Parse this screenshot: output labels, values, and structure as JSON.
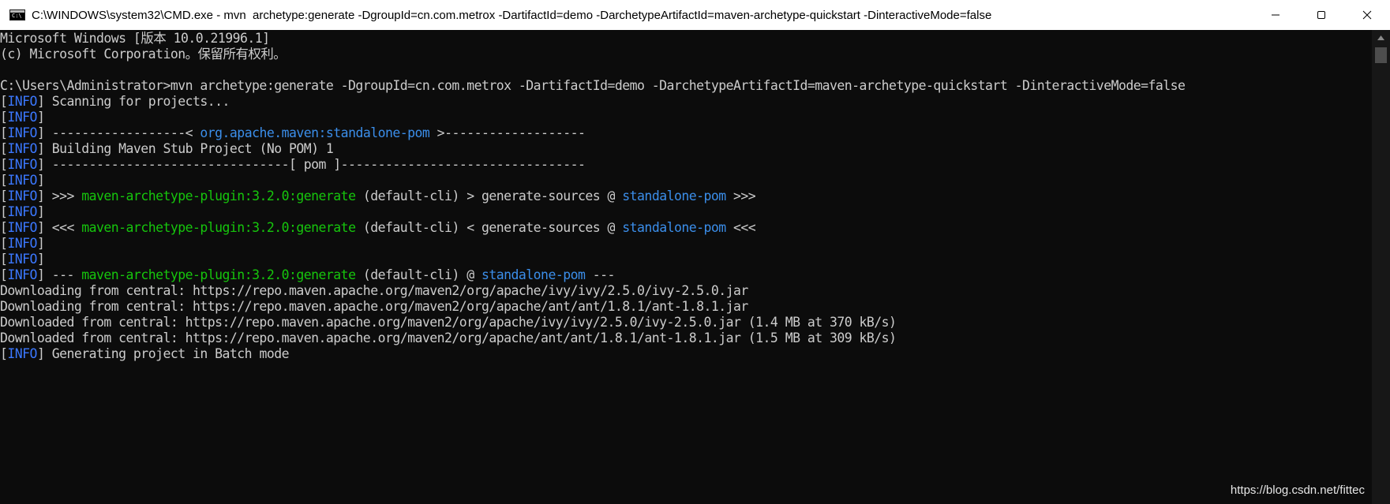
{
  "window": {
    "title": "C:\\WINDOWS\\system32\\CMD.exe - mvn  archetype:generate -DgroupId=cn.com.metrox -DartifactId=demo -DarchetypeArtifactId=maven-archetype-quickstart -DinteractiveMode=false",
    "icon": "cmd-icon",
    "controls": [
      "minimize-icon",
      "maximize-icon",
      "close-icon"
    ]
  },
  "colors": {
    "background": "#0c0c0c",
    "text": "#cccccc",
    "info": "#3b78ff",
    "link": "#3b8eea",
    "plugin": "#16c60c",
    "titlebar": "#ffffff"
  },
  "console": {
    "lines": [
      [
        {
          "t": "Microsoft Windows [版本 10.0.21996.1]",
          "c": "default"
        }
      ],
      [
        {
          "t": "(c) Microsoft Corporation。保留所有权利。",
          "c": "default"
        }
      ],
      [
        {
          "t": "",
          "c": "default"
        }
      ],
      [
        {
          "t": "C:\\Users\\Administrator>mvn archetype:generate -DgroupId=cn.com.metrox -DartifactId=demo -DarchetypeArtifactId=maven-archetype-quickstart -DinteractiveMode=false",
          "c": "default"
        }
      ],
      [
        {
          "t": "[",
          "c": "default"
        },
        {
          "t": "INFO",
          "c": "blue"
        },
        {
          "t": "] Scanning for projects...",
          "c": "default"
        }
      ],
      [
        {
          "t": "[",
          "c": "default"
        },
        {
          "t": "INFO",
          "c": "blue"
        },
        {
          "t": "]",
          "c": "default"
        }
      ],
      [
        {
          "t": "[",
          "c": "default"
        },
        {
          "t": "INFO",
          "c": "blue"
        },
        {
          "t": "] ------------------< ",
          "c": "default"
        },
        {
          "t": "org.apache.maven:standalone-pom",
          "c": "link"
        },
        {
          "t": " >-------------------",
          "c": "default"
        }
      ],
      [
        {
          "t": "[",
          "c": "default"
        },
        {
          "t": "INFO",
          "c": "blue"
        },
        {
          "t": "] Building Maven Stub Project (No POM) 1",
          "c": "default"
        }
      ],
      [
        {
          "t": "[",
          "c": "default"
        },
        {
          "t": "INFO",
          "c": "blue"
        },
        {
          "t": "] --------------------------------[ pom ]---------------------------------",
          "c": "default"
        }
      ],
      [
        {
          "t": "[",
          "c": "default"
        },
        {
          "t": "INFO",
          "c": "blue"
        },
        {
          "t": "]",
          "c": "default"
        }
      ],
      [
        {
          "t": "[",
          "c": "default"
        },
        {
          "t": "INFO",
          "c": "blue"
        },
        {
          "t": "] >>> ",
          "c": "default"
        },
        {
          "t": "maven-archetype-plugin:3.2.0:generate",
          "c": "green"
        },
        {
          "t": " (default-cli) > generate-sources @ ",
          "c": "default"
        },
        {
          "t": "standalone-pom",
          "c": "link"
        },
        {
          "t": " >>>",
          "c": "default"
        }
      ],
      [
        {
          "t": "[",
          "c": "default"
        },
        {
          "t": "INFO",
          "c": "blue"
        },
        {
          "t": "]",
          "c": "default"
        }
      ],
      [
        {
          "t": "[",
          "c": "default"
        },
        {
          "t": "INFO",
          "c": "blue"
        },
        {
          "t": "] <<< ",
          "c": "default"
        },
        {
          "t": "maven-archetype-plugin:3.2.0:generate",
          "c": "green"
        },
        {
          "t": " (default-cli) < generate-sources @ ",
          "c": "default"
        },
        {
          "t": "standalone-pom",
          "c": "link"
        },
        {
          "t": " <<<",
          "c": "default"
        }
      ],
      [
        {
          "t": "[",
          "c": "default"
        },
        {
          "t": "INFO",
          "c": "blue"
        },
        {
          "t": "]",
          "c": "default"
        }
      ],
      [
        {
          "t": "[",
          "c": "default"
        },
        {
          "t": "INFO",
          "c": "blue"
        },
        {
          "t": "]",
          "c": "default"
        }
      ],
      [
        {
          "t": "[",
          "c": "default"
        },
        {
          "t": "INFO",
          "c": "blue"
        },
        {
          "t": "] --- ",
          "c": "default"
        },
        {
          "t": "maven-archetype-plugin:3.2.0:generate",
          "c": "green"
        },
        {
          "t": " (default-cli) @ ",
          "c": "default"
        },
        {
          "t": "standalone-pom",
          "c": "link"
        },
        {
          "t": " ---",
          "c": "default"
        }
      ],
      [
        {
          "t": "Downloading from central: https://repo.maven.apache.org/maven2/org/apache/ivy/ivy/2.5.0/ivy-2.5.0.jar",
          "c": "default"
        }
      ],
      [
        {
          "t": "Downloading from central: https://repo.maven.apache.org/maven2/org/apache/ant/ant/1.8.1/ant-1.8.1.jar",
          "c": "default"
        }
      ],
      [
        {
          "t": "Downloaded from central: https://repo.maven.apache.org/maven2/org/apache/ivy/ivy/2.5.0/ivy-2.5.0.jar (1.4 MB at 370 kB/s)",
          "c": "default"
        }
      ],
      [
        {
          "t": "Downloaded from central: https://repo.maven.apache.org/maven2/org/apache/ant/ant/1.8.1/ant-1.8.1.jar (1.5 MB at 309 kB/s)",
          "c": "default"
        }
      ],
      [
        {
          "t": "[",
          "c": "default"
        },
        {
          "t": "INFO",
          "c": "blue"
        },
        {
          "t": "] Generating project in Batch mode",
          "c": "default"
        }
      ]
    ]
  },
  "watermark": "https://blog.csdn.net/fittec"
}
